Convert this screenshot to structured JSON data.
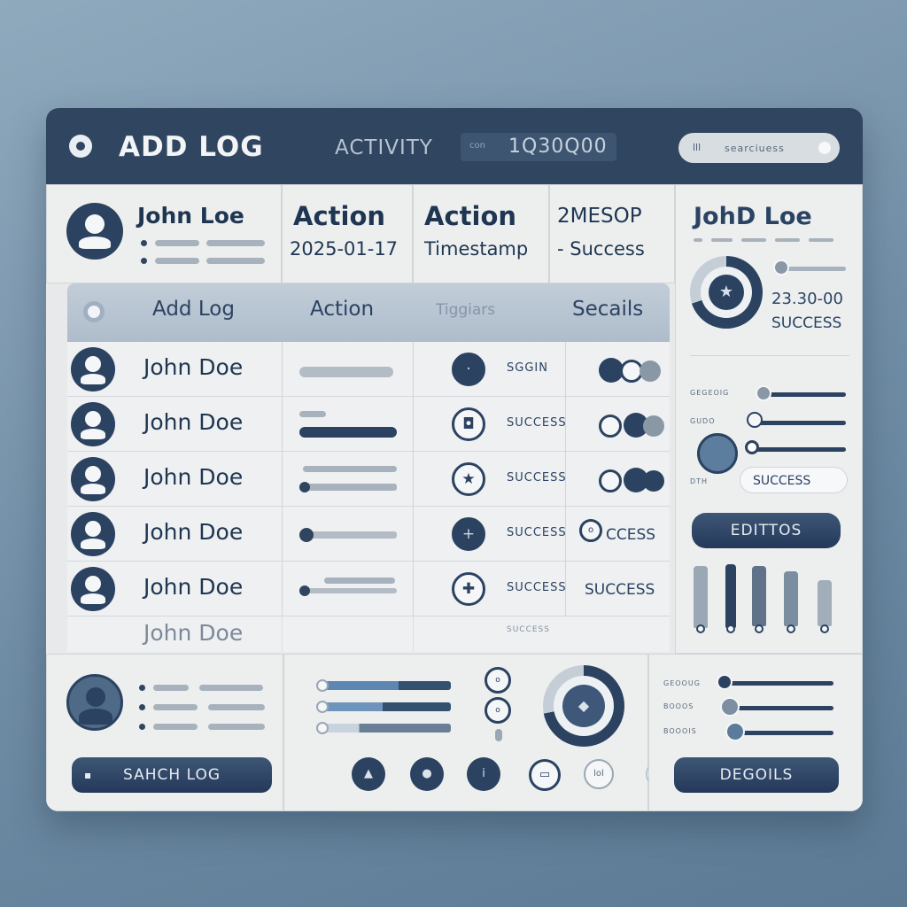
{
  "titlebar": {
    "title": "ADD LOG",
    "activity": "ACTIVITY",
    "counter_prefix": "con",
    "counter_value": "1Q30Q00",
    "search_icon": "lll",
    "search_text": "searciuess"
  },
  "summary": {
    "user_name": "John Loe",
    "col1_title": "Action",
    "col1_value": "2025-01-17",
    "col2_title": "Action",
    "col2_value": "Timestamp",
    "col3_title": "2MESOP",
    "col3_value": "- Success"
  },
  "table": {
    "headers": [
      "Add Log",
      "Action",
      "Tiggiars",
      "Secails"
    ],
    "rows": [
      {
        "name": "John Doe",
        "status_text": "SGGIN"
      },
      {
        "name": "John Doe",
        "status_text": "SUCCESS"
      },
      {
        "name": "John Doe",
        "status_text": "SUCCESS"
      },
      {
        "name": "John Doe",
        "status_text": "SUCCESS"
      },
      {
        "name": "John Doe",
        "status_text": "SUCCESS"
      },
      {
        "name": "John Doe",
        "status_text": "SUCCESS"
      }
    ],
    "row4_success": "CCESS",
    "row5_success": "SUCCESS"
  },
  "right_panel": {
    "name": "JohD Loe",
    "time": "23.30-00",
    "status": "SUCCESS",
    "slider_labels": [
      "GEGEOIG",
      "GUDO",
      "DTH"
    ],
    "status_pill": "SUCCESS",
    "edit_button": "EDITTOS"
  },
  "bottom_left": {
    "button": "SAHCH LOG"
  },
  "bottom_right": {
    "labels": [
      "GEOOUG",
      "BOOOS",
      "BOOOIS"
    ],
    "button": "DEGOILS"
  },
  "colors": {
    "primary": "#2b4261",
    "titlebar": "#2f4560",
    "background": "#7f9bb2"
  }
}
